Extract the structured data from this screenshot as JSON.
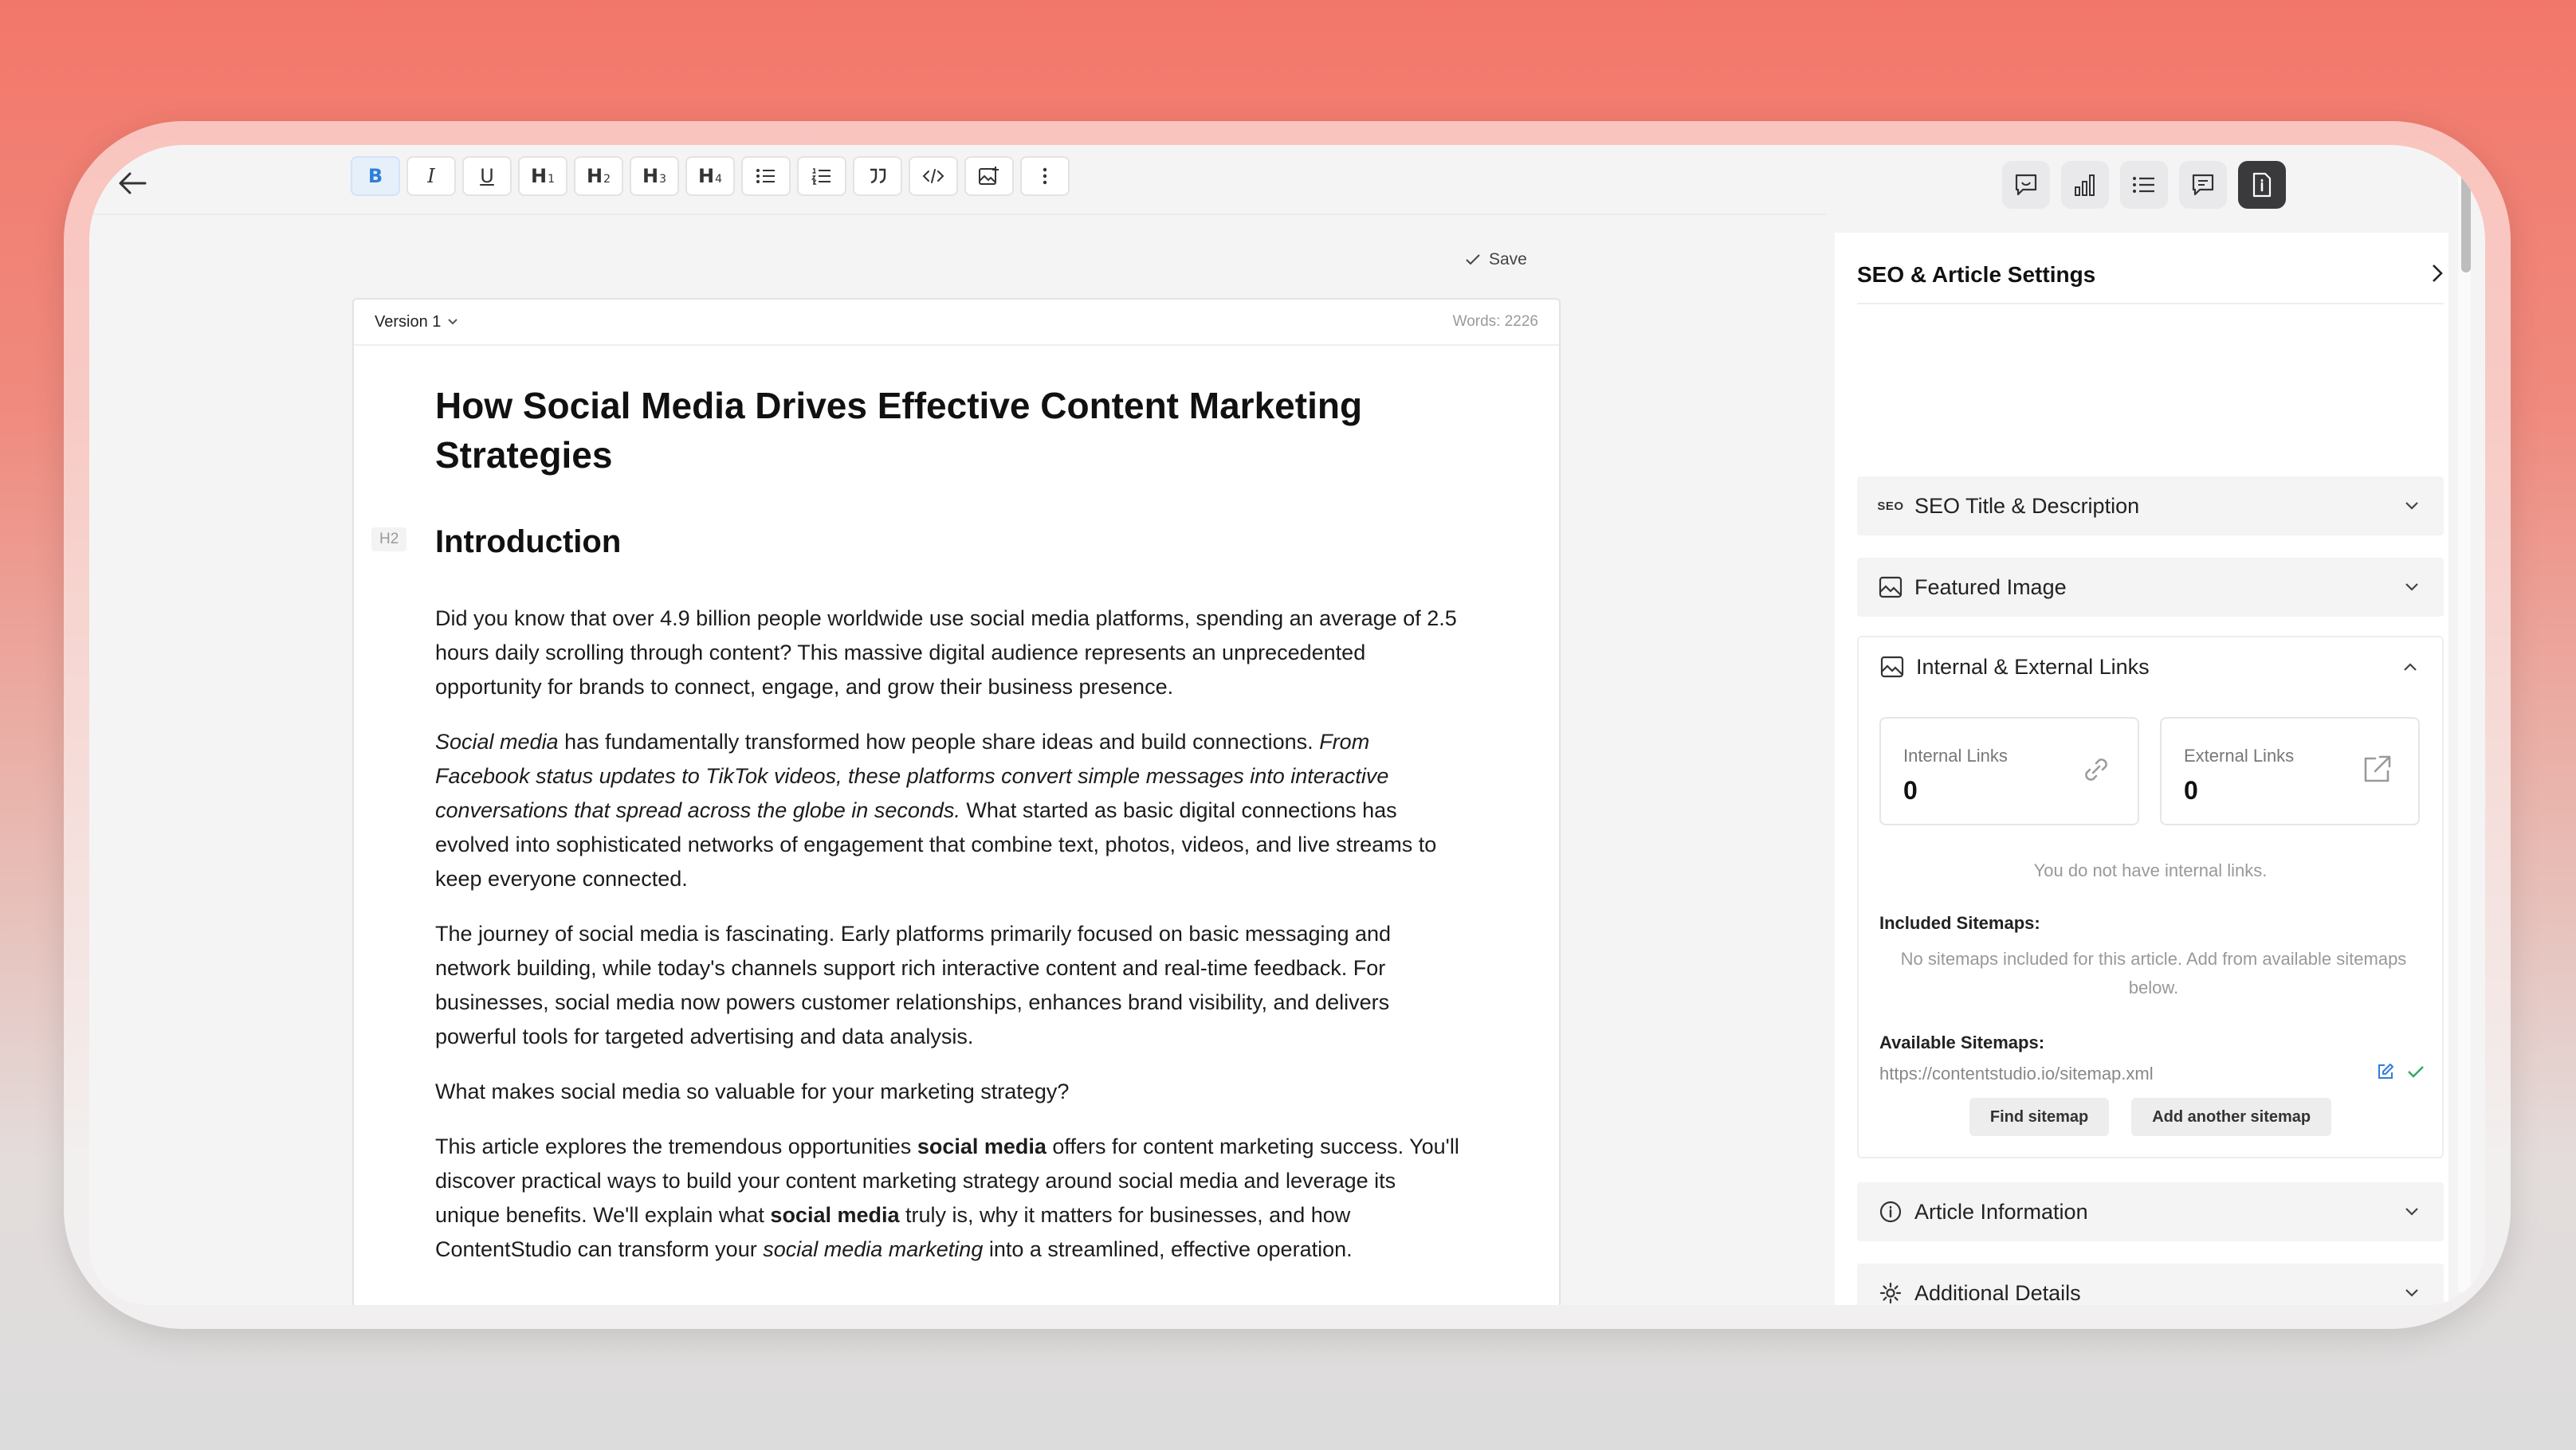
{
  "toolbar": {
    "buttons": [
      {
        "name": "bold-button",
        "label": "B"
      },
      {
        "name": "italic-button",
        "label": "I"
      },
      {
        "name": "underline-button",
        "label": "U"
      },
      {
        "name": "heading1-button",
        "label": "H",
        "sub": "1"
      },
      {
        "name": "heading2-button",
        "label": "H",
        "sub": "2"
      },
      {
        "name": "heading3-button",
        "label": "H",
        "sub": "3"
      },
      {
        "name": "heading4-button",
        "label": "H",
        "sub": "4"
      }
    ],
    "save_label": "Save"
  },
  "document": {
    "version_label": "Version 1",
    "word_count": "Words: 2226",
    "title": "How Social Media Drives Effective Content Marketing Strategies",
    "h2_tag": "H2",
    "h2_text": "Introduction",
    "paragraphs": [
      "Did you know that over 4.9 billion people worldwide use social media platforms, spending an average of 2.5 hours daily scrolling through content? This massive digital audience represents an unprecedented opportunity for brands to connect, engage, and grow their business presence.",
      "",
      "The journey of social media is fascinating. Early platforms primarily focused on basic messaging and network building, while today's channels support rich interactive content and real-time feedback. For businesses, social media now powers customer relationships, enhances brand visibility, and delivers powerful tools for targeted advertising and data analysis.",
      "What makes social media so valuable for your marketing strategy?",
      ""
    ],
    "p2": {
      "a": "Social media",
      "b": " has fundamentally transformed how people share ideas and build connections. ",
      "c": "From Facebook status updates to TikTok videos, these platforms convert simple messages into interactive conversations that spread across the globe in seconds.",
      "d": " What started as basic digital connections has evolved into sophisticated networks of engagement that combine text, photos, videos, and live streams to keep everyone connected."
    },
    "p5": {
      "a": "This article explores the tremendous opportunities ",
      "b": "social media",
      "c": " offers for content marketing success. You'll discover practical ways to build your content marketing strategy around social media and leverage its unique benefits. We'll explain what ",
      "d": "social media",
      "e": " truly is, why it matters for businesses, and how ContentStudio can transform your ",
      "f": "social media marketing",
      "g": " into a streamlined, effective operation."
    }
  },
  "sidebar": {
    "title": "SEO & Article Settings",
    "seo_icon_text": "SEO",
    "sections": {
      "seo": "SEO Title & Description",
      "featured": "Featured Image",
      "links": "Internal & External Links",
      "article_info": "Article Information",
      "additional": "Additional Details"
    },
    "links": {
      "internal_label": "Internal Links",
      "internal_value": "0",
      "external_label": "External Links",
      "external_value": "0",
      "no_links_text": "You do not have internal links.",
      "included_label": "Included Sitemaps:",
      "included_text": "No sitemaps included for this article. Add from available sitemaps below.",
      "available_label": "Available Sitemaps:",
      "sitemap_url": "https://contentstudio.io/sitemap.xml",
      "find_btn": "Find sitemap",
      "add_btn": "Add another sitemap"
    }
  },
  "colors": {
    "accent": "#2f7ed8",
    "success": "#2eaa5c",
    "active_tab": "#3a3a3d"
  }
}
